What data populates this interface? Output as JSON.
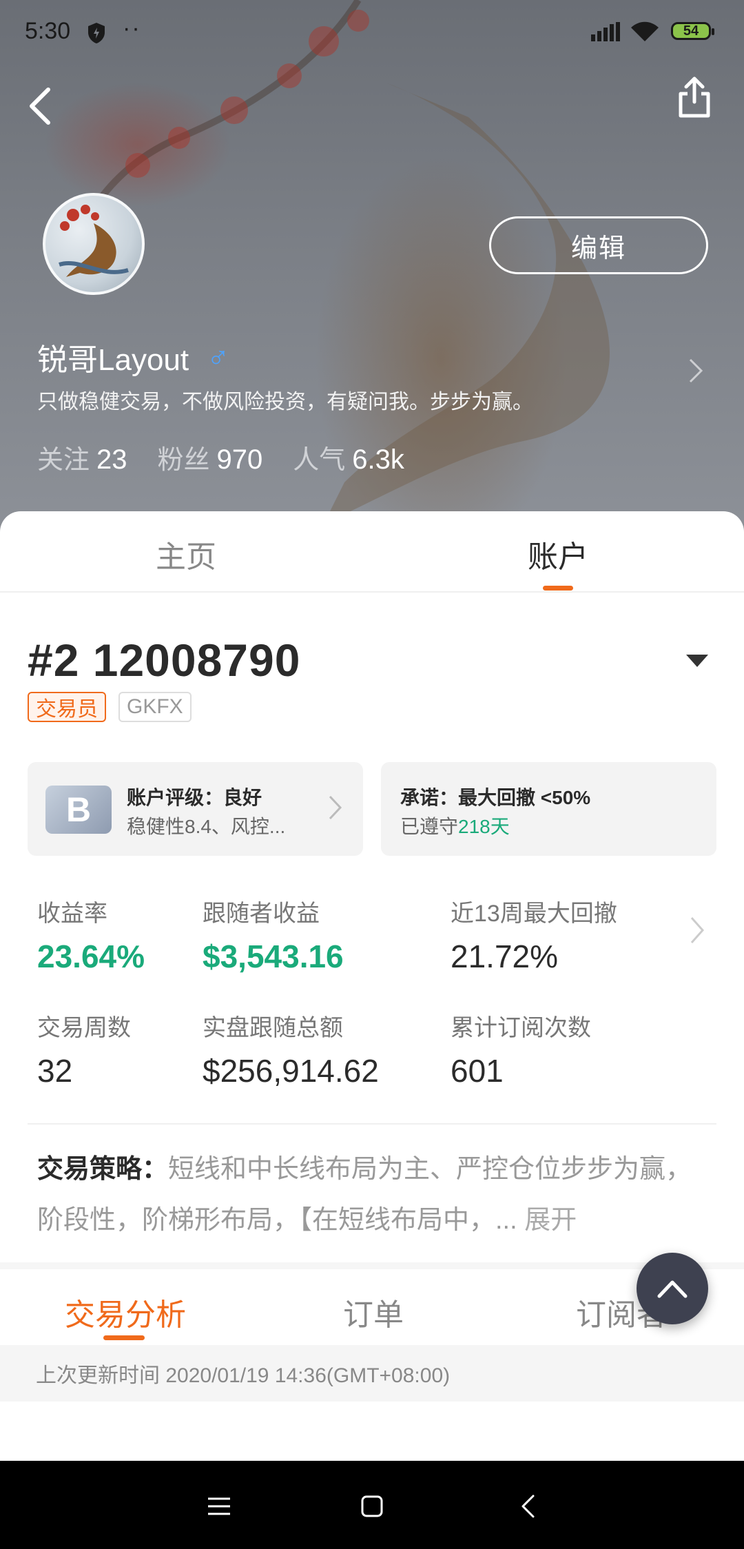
{
  "status_bar": {
    "time": "5:30",
    "dots": "··",
    "battery": "54"
  },
  "profile": {
    "name": "锐哥Layout",
    "gender_symbol": "♂",
    "bio": "只做稳健交易，不做风险投资，有疑问我。步步为赢。",
    "edit_label": "编辑",
    "stats": [
      {
        "label": "关注",
        "value": "23"
      },
      {
        "label": "粉丝",
        "value": "970"
      },
      {
        "label": "人气",
        "value": "6.3k"
      }
    ]
  },
  "main_tabs": {
    "home": "主页",
    "account": "账户"
  },
  "account": {
    "number": "#2 12008790",
    "tag_role": "交易员",
    "tag_broker": "GKFX",
    "grade_letter": "B",
    "rating_title": "账户评级：良好",
    "rating_sub": "稳健性8.4、风控...",
    "promise_title": "承诺：最大回撤 <50%",
    "promise_prefix": "已遵守",
    "promise_days": "218天"
  },
  "metrics": [
    {
      "label": "收益率",
      "value": "23.64%"
    },
    {
      "label": "跟随者收益",
      "value": "$3,543.16"
    },
    {
      "label": "近13周最大回撤",
      "value": "21.72%"
    },
    {
      "label": "交易周数",
      "value": "32"
    },
    {
      "label": "实盘跟随总额",
      "value": "$256,914.62"
    },
    {
      "label": "累计订阅次数",
      "value": "601"
    }
  ],
  "strategy": {
    "label": "交易策略：",
    "text": "短线和中长线布局为主、严控仓位步步为赢，阶段性，阶梯形布局，【在短线布局中，...",
    "more": "展开"
  },
  "sub_tabs": {
    "analysis": "交易分析",
    "orders": "订单",
    "subscribers": "订阅者"
  },
  "update_text": "上次更新时间 2020/01/19 14:36(GMT+08:00)",
  "colors": {
    "accent": "#f06a1b",
    "green": "#1aaa7a",
    "gender": "#4da3ff",
    "scroll_button": "#3e4150"
  },
  "icons": {
    "back": "back-arrow-icon",
    "share": "share-icon",
    "dropdown": "triangle-down-icon",
    "scroll_top": "chevron-up-icon"
  }
}
